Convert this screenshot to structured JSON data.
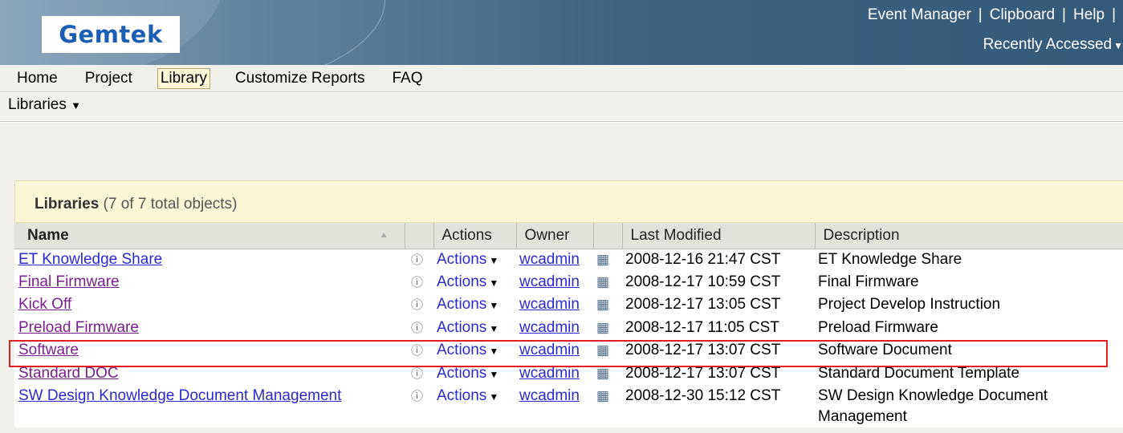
{
  "header": {
    "logo": "Gemtek",
    "links": [
      "Event Manager",
      "Clipboard",
      "Help"
    ],
    "separator": "|",
    "recently_accessed": "Recently Accessed"
  },
  "nav": {
    "items": [
      {
        "label": "Home",
        "active": false
      },
      {
        "label": "Project",
        "active": false
      },
      {
        "label": "Library",
        "active": true
      },
      {
        "label": "Customize Reports",
        "active": false
      },
      {
        "label": "FAQ",
        "active": false
      }
    ],
    "subnav_label": "Libraries"
  },
  "panel": {
    "title": "Libraries",
    "count": "(7 of 7 total objects)"
  },
  "table": {
    "columns": {
      "name": "Name",
      "actions": "Actions",
      "owner": "Owner",
      "last_modified": "Last Modified",
      "description": "Description"
    },
    "rows": [
      {
        "name": "ET Knowledge Share",
        "visited": false,
        "actions": "Actions",
        "owner": "wcadmin",
        "modified": "2008-12-16 21:47 CST",
        "description": "ET Knowledge Share"
      },
      {
        "name": "Final Firmware",
        "visited": true,
        "actions": "Actions",
        "owner": "wcadmin",
        "modified": "2008-12-17 10:59 CST",
        "description": "Final Firmware"
      },
      {
        "name": "Kick Off",
        "visited": true,
        "actions": "Actions",
        "owner": "wcadmin",
        "modified": "2008-12-17 13:05 CST",
        "description": "Project Develop Instruction"
      },
      {
        "name": "Preload Firmware",
        "visited": true,
        "actions": "Actions",
        "owner": "wcadmin",
        "modified": "2008-12-17 11:05 CST",
        "description": "Preload Firmware"
      },
      {
        "name": "Software",
        "visited": true,
        "actions": "Actions",
        "owner": "wcadmin",
        "modified": "2008-12-17 13:07 CST",
        "description": "Software Document"
      },
      {
        "name": "Standard DOC",
        "visited": true,
        "actions": "Actions",
        "owner": "wcadmin",
        "modified": "2008-12-17 13:07 CST",
        "description": "Standard Document Template"
      },
      {
        "name": "SW Design Knowledge Document Management",
        "visited": false,
        "actions": "Actions",
        "owner": "wcadmin",
        "modified": "2008-12-30 15:12 CST",
        "description": "SW Design Knowledge Document Management"
      }
    ]
  },
  "colors": {
    "highlight": "#e02020",
    "link": "#2a2ad0",
    "visited_link": "#7a1f8e",
    "header": "#3f6482"
  },
  "icons": [
    "info-icon",
    "chevron-down-icon",
    "owner-icon",
    "sort-icon"
  ]
}
